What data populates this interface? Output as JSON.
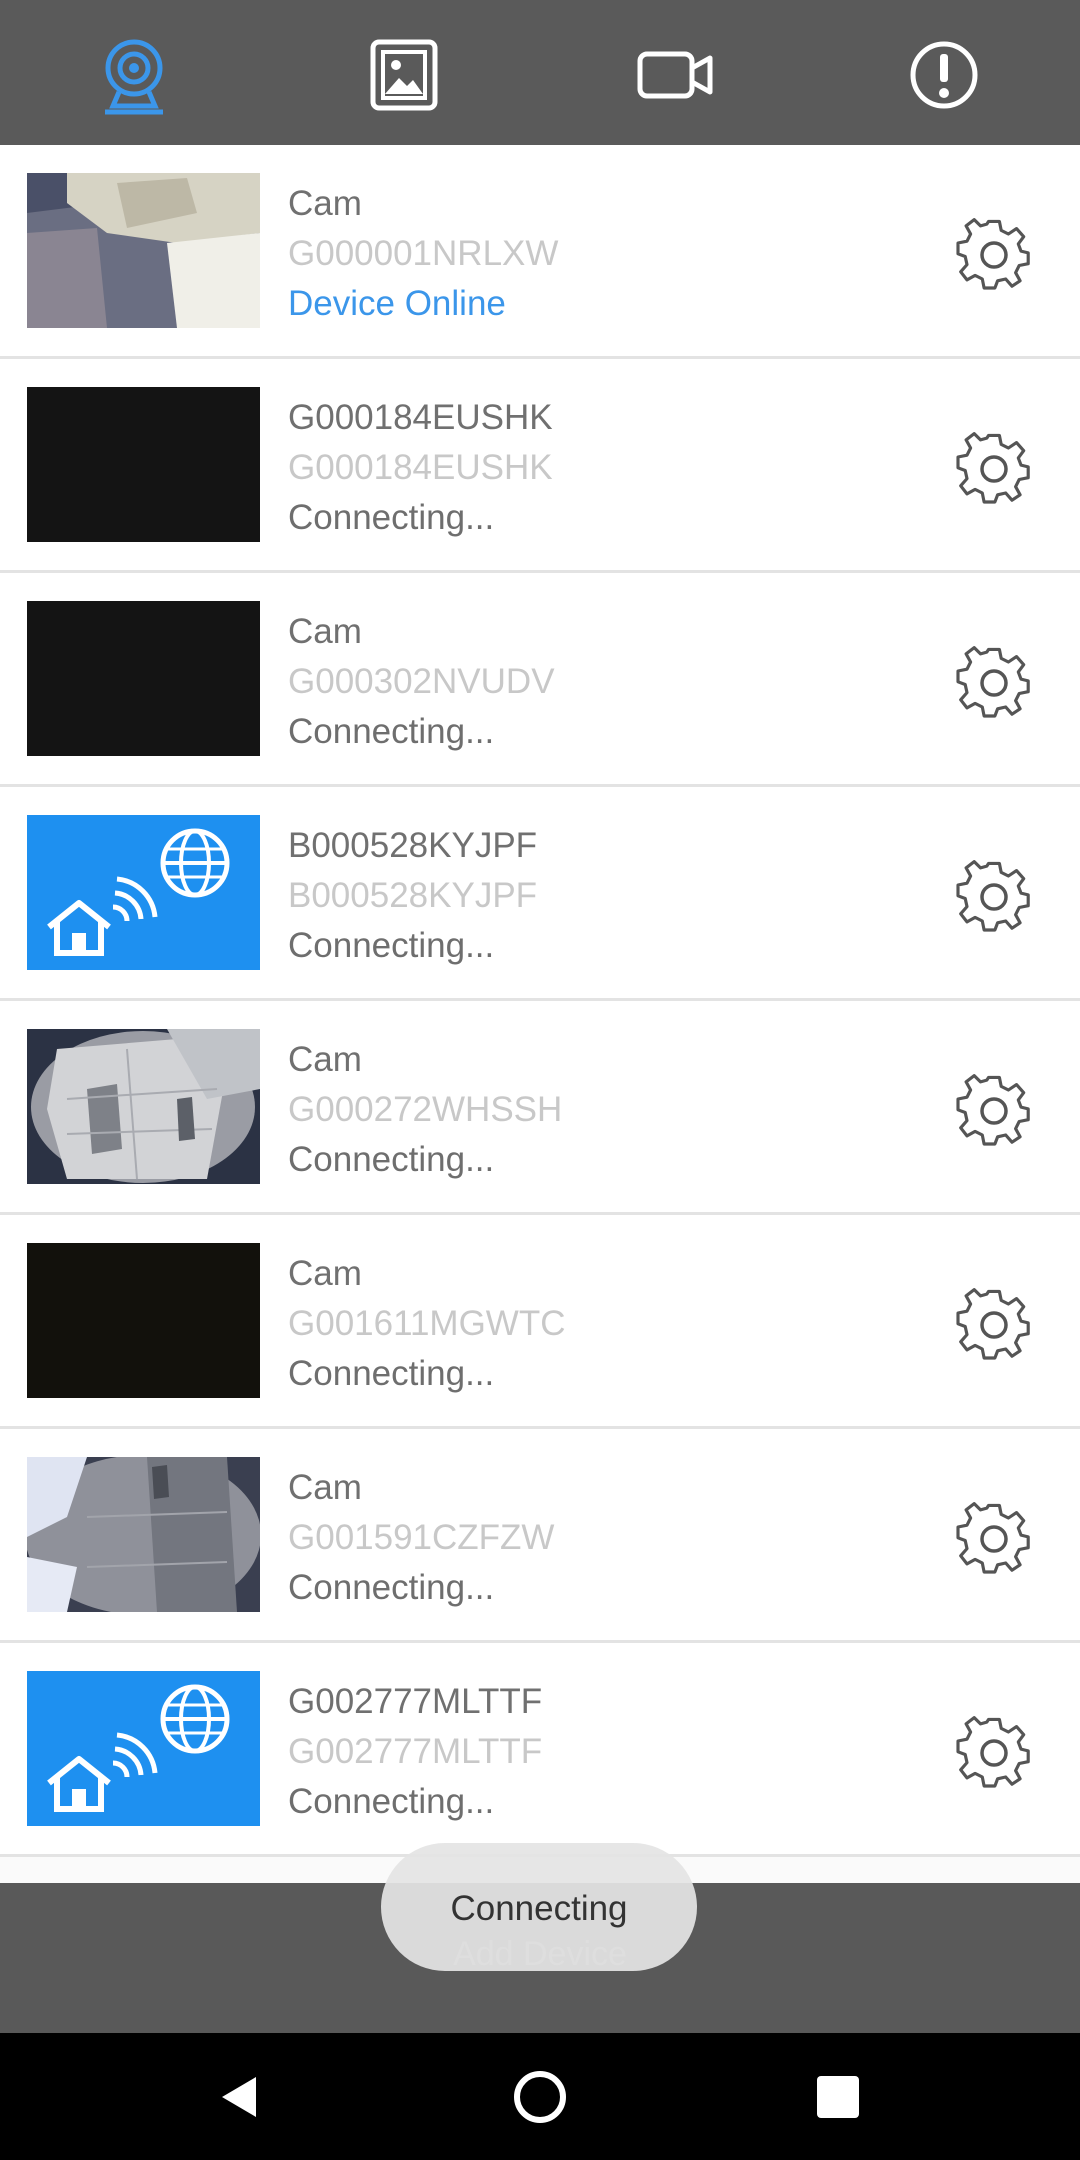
{
  "colors": {
    "accent": "#3b96ea",
    "topbar": "#5a5a5a",
    "bottombar": "#595959",
    "navbar": "#000000"
  },
  "top_tabs": [
    {
      "icon": "webcam-icon",
      "active": true
    },
    {
      "icon": "gallery-icon",
      "active": false
    },
    {
      "icon": "video-camera-icon",
      "active": false
    },
    {
      "icon": "alert-icon",
      "active": false
    }
  ],
  "devices": [
    {
      "name": "Cam",
      "uid": "G000001NRLXW",
      "status": "Device Online",
      "thumbnail": "camera-snapshot"
    },
    {
      "name": "G000184EUSHK",
      "uid": "G000184EUSHK",
      "status": "Connecting...",
      "thumbnail": "black"
    },
    {
      "name": "Cam",
      "uid": "G000302NVUDV",
      "status": "Connecting...",
      "thumbnail": "black"
    },
    {
      "name": "B000528KYJPF",
      "uid": "B000528KYJPF",
      "status": "Connecting...",
      "thumbnail": "network-placeholder"
    },
    {
      "name": "Cam",
      "uid": "G000272WHSSH",
      "status": "Connecting...",
      "thumbnail": "camera-snapshot"
    },
    {
      "name": "Cam",
      "uid": "G001611MGWTC",
      "status": "Connecting...",
      "thumbnail": "black"
    },
    {
      "name": "Cam",
      "uid": "G001591CZFZW",
      "status": "Connecting...",
      "thumbnail": "camera-snapshot"
    },
    {
      "name": "G002777MLTTF",
      "uid": "G002777MLTTF",
      "status": "Connecting...",
      "thumbnail": "network-placeholder"
    }
  ],
  "bottom": {
    "add_device_label": "Add Device"
  },
  "toast": {
    "text": "Connecting"
  },
  "system_nav": {
    "back": "back-icon",
    "home": "home-icon",
    "recents": "recents-icon"
  }
}
